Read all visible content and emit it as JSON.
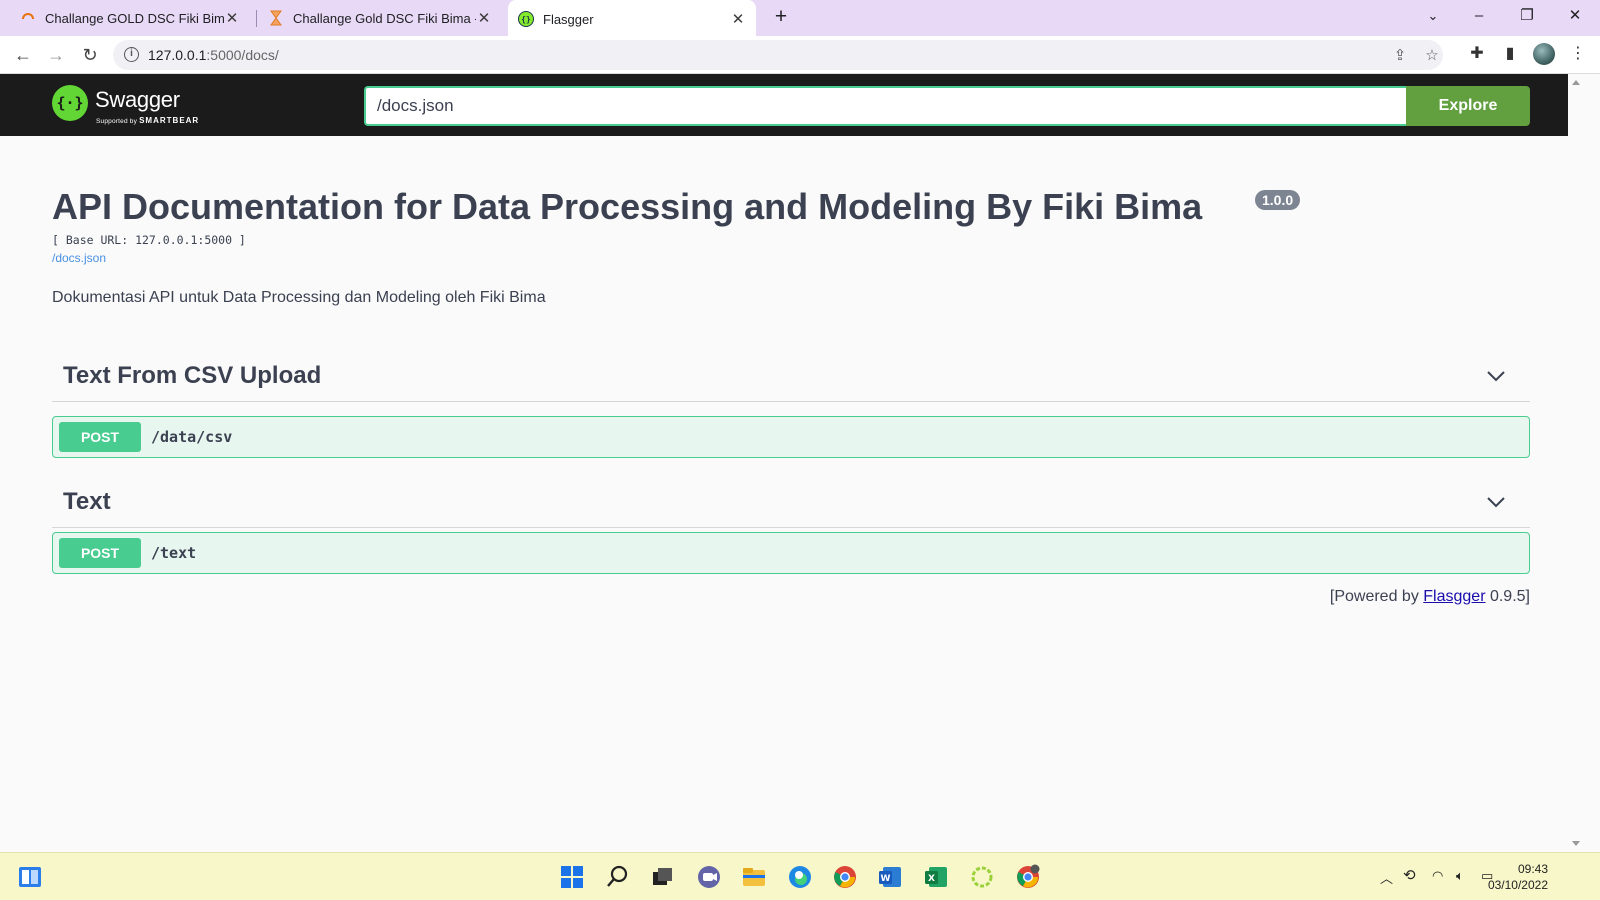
{
  "browser": {
    "tabs": [
      {
        "title": "Challange GOLD DSC Fiki Bima/",
        "active": false
      },
      {
        "title": "Challange Gold DSC Fiki Bima - J",
        "active": false
      },
      {
        "title": "Flasgger",
        "active": true
      }
    ],
    "url_host": "127.0.0.1",
    "url_rest": ":5000/docs/"
  },
  "swagger": {
    "brand": "Swagger",
    "brand_sub": "Supported by",
    "brand_sub_company": "SMARTBEAR",
    "spec_url": "/docs.json",
    "explore_label": "Explore"
  },
  "info": {
    "title": "API Documentation for Data Processing and Modeling By Fiki Bima",
    "version": "1.0.0",
    "base_url": "[ Base URL: 127.0.0.1:5000 ]",
    "spec_link": "/docs.json",
    "description": "Dokumentasi API untuk Data Processing dan Modeling oleh Fiki Bima"
  },
  "tags": [
    {
      "name": "Text From CSV Upload",
      "operations": [
        {
          "method": "POST",
          "path": "/data/csv"
        }
      ]
    },
    {
      "name": "Text",
      "operations": [
        {
          "method": "POST",
          "path": "/text"
        }
      ]
    }
  ],
  "footer": {
    "prefix": "[Powered by ",
    "link": "Flasgger",
    "suffix": " 0.9.5]"
  },
  "taskbar": {
    "time": "09:43",
    "date": "03/10/2022"
  },
  "colors": {
    "post": "#49cc90",
    "explore": "#62a03f",
    "tabstrip": "#e8d9f6",
    "taskbar": "#f7f7c9"
  }
}
